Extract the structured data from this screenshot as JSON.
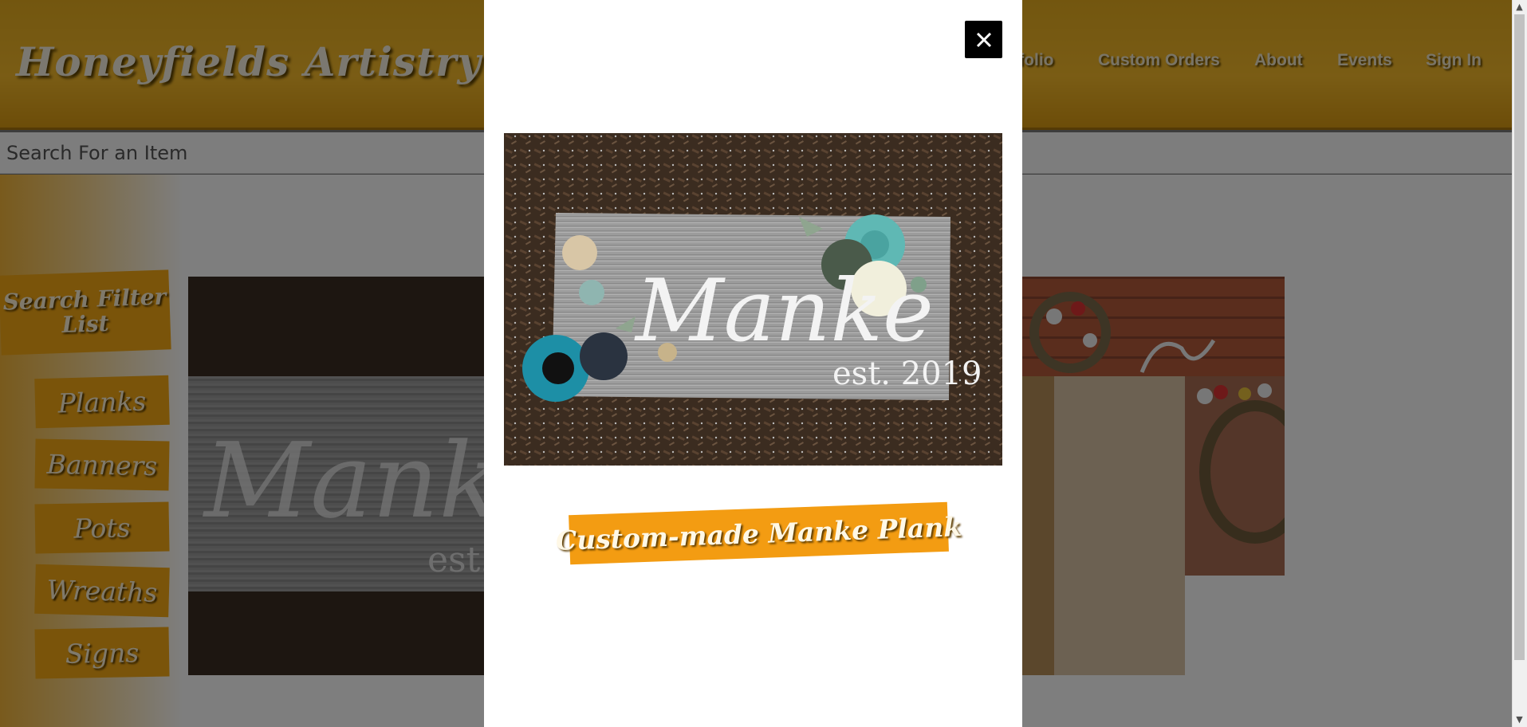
{
  "site": {
    "title": "Honeyfields Artistry"
  },
  "nav": {
    "items": [
      "rtfolio",
      "Custom Orders",
      "About",
      "Events",
      "Sign In"
    ]
  },
  "search": {
    "placeholder": "Search For an Item",
    "value": ""
  },
  "filters": {
    "title": "Search Filter List",
    "items": [
      "Planks",
      "Banners",
      "Pots",
      "Wreaths",
      "Signs"
    ]
  },
  "background_thumb": {
    "text_main": "Manke",
    "text_sub": "est."
  },
  "modal": {
    "close_label": "×",
    "photo": {
      "text_main": "Manke",
      "text_sub": "est. 2019"
    },
    "caption": "Custom-made Manke Plank"
  },
  "scrollbar": {
    "up": "▲",
    "down": "▼"
  },
  "colors": {
    "brand": "#f4a814",
    "header": "#e6ad1f",
    "overlay": "rgba(0,0,0,0.5)",
    "close_bg": "#000000"
  }
}
